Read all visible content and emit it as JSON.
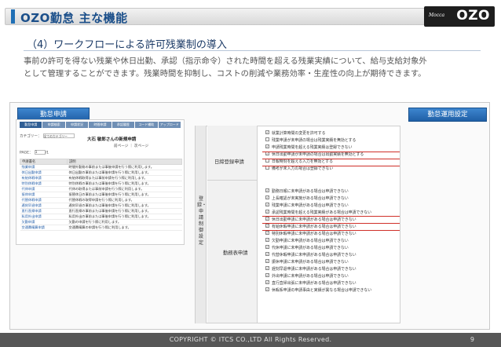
{
  "header": {
    "title": "OZO勤怠 主な機能",
    "logo_small": "Mocca",
    "logo_main": "OZO"
  },
  "subtitle": "（4）ワークフローによる許可残業制の導入",
  "description": [
    "事前の許可を得ない残業や休日出勤、承認（指示命令）された時間を超える残業実績について、給与支給対象外",
    "として管理することができます。残業時間を抑制し、コストの削減や業務効率・生産性の向上が期待できます。"
  ],
  "buttons": {
    "left": "勤怠申請",
    "right": "勤怠運用設定"
  },
  "left_screen": {
    "tabs": [
      "勤怠申請",
      "申請検索",
      "申請状況",
      "時間申請",
      "承認履歴",
      "コード補助",
      "アップロード"
    ],
    "category_label": "カテゴリー：",
    "category_value": "全てのカテゴリー",
    "owner_title": "大石 敏郎さんの新規申請",
    "page_label": "PAGE：",
    "page_value": "1",
    "page_total": "/1",
    "pager": "前ページ ｜ 次ページ",
    "columns": [
      "申請書名",
      "説明"
    ],
    "rows": [
      [
        "残業申請",
        "時間外勤務の事前または事後申請を行う際に利用します。"
      ],
      [
        "休日出勤申請",
        "休日出勤の事前または事後申請を行う際に利用します。"
      ],
      [
        "有給休暇申請",
        "有給休暇取得または事前申請を行う際に利用します。"
      ],
      [
        "特別休暇申請",
        "特別休暇の事前または事後申請を行う際に利用します。"
      ],
      [
        "代休申請",
        "代休の取得または事前申請を行う際に利用します。"
      ],
      [
        "振休申請",
        "振替休日の事前または事後申請を行う際に利用します。"
      ],
      [
        "代替休暇申請",
        "代替休暇の取得申請を行う際に利用します。"
      ],
      [
        "遅刻早退申請",
        "遅刻早退の事前または事後申請を行う際に利用します。"
      ],
      [
        "直行直帰申請",
        "直行直帰の事前または事後申請を行う際に利用します。"
      ],
      [
        "私用外出申請",
        "私用外出の事前または事後申請を行う際に利用します。"
      ],
      [
        "欠勤申請",
        "欠勤の申請を行う際に利用します。"
      ],
      [
        "交通費精算申請",
        "交通費精算の申請を行う際に利用します。"
      ]
    ]
  },
  "right_screen": {
    "vertical_label": "登録・申請制御設定",
    "group1_label": "日締登録申請",
    "group1_items": [
      "就業計算時間の変更を許可する",
      "残業申請が未申請の場合は残業実績を無効とする",
      "申請残業時間を超える残業実績は登録できない",
      "休日出勤申請が未申請の場合は出勤実績を無効とする",
      "日報時刻を超える入力を無効とする",
      "備考が未入力の場合は登録できない"
    ],
    "group1_checked": [
      true,
      false,
      true,
      true,
      false,
      false
    ],
    "group2_label": "勤務表申請",
    "group2_items": [
      "勤務日報に未申請がある場合は申請できない",
      "上長確認が未実施がある場合は申請できない",
      "残業申請に未申請がある場合は申請できない",
      "承認残業時間を超える残業実績がある場合は申請できない",
      "休日出勤申請に未申請がある場合は申請できない",
      "有給休暇申請に未申請がある場合は申請できない",
      "特別休暇申請に未申請がある場合は申請できない",
      "欠勤申請に未申請がある場合は申請できない",
      "代休申請に未申請がある場合は申請できない",
      "代替休暇申請に未申請がある場合は申請できない",
      "振休申請に未申請がある場合は申請できない",
      "遅刻早退申請に未申請がある場合は申請できない",
      "外出申請に未申請がある場合は申請できない",
      "直行直帰出張に未申請がある場合は申請できない",
      "休暇系申請の申請事由と実績が異なる場合は申請できない"
    ]
  },
  "footer": {
    "copyright": "COPYRIGHT © ITCS CO.,LTD All Rights Reserved.",
    "page": "9"
  },
  "colors": {
    "accent": "#1f6fb5",
    "button": "#2b6db5",
    "highlight": "#d0302a",
    "footer": "#575757"
  }
}
